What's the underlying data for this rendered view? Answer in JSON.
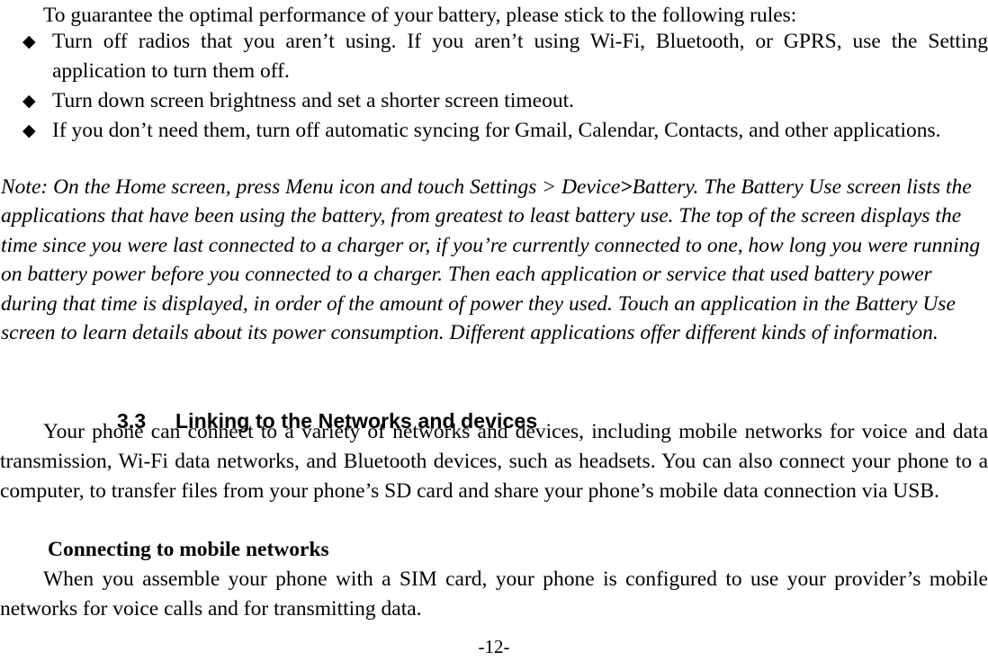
{
  "document": {
    "intro_line": "To guarantee the optimal performance of your battery, please stick to the following rules:",
    "bullet_glyph": "◆",
    "bullets": [
      "Turn off radios that you aren’t using. If you aren’t using Wi-Fi, Bluetooth, or GPRS, use the Setting application to turn them off.",
      "Turn down screen brightness and set a shorter screen timeout.",
      "If you don’t need them, turn off automatic syncing for Gmail, Calendar, Contacts, and other applications."
    ],
    "note": {
      "lead": "Note: On the Home screen, press Menu icon and touch Settings > Device",
      "bold_fragment": ">",
      "rest": "Battery. The Battery Use screen lists the applications that have been using the battery, from greatest to least battery use. The top of the screen displays the time since you were last connected to a charger or, if you’re currently connected to one, how long you were running on battery power before you connected to a charger. Then each application or service that used battery power during that time is displayed, in order of the amount of power they used. Touch an application in the Battery Use screen to learn details about its power consumption. Different applications offer different kinds of information."
    },
    "section": {
      "number": "3.3",
      "title": "Linking to the Networks and devices"
    },
    "paragraph_networks": "Your phone can connect to a variety of networks and devices, including mobile networks for voice and data transmission, Wi-Fi data networks, and Bluetooth devices, such as headsets. You can also connect your phone to a computer, to transfer files from your phone’s SD card and share your phone’s mobile data connection via USB.",
    "subheading_connecting": "Connecting to mobile networks",
    "paragraph_sim": "When you assemble your phone with a SIM card, your phone is configured to use your provider’s mobile networks for voice calls and for transmitting data.",
    "footer_page": "-12-"
  }
}
